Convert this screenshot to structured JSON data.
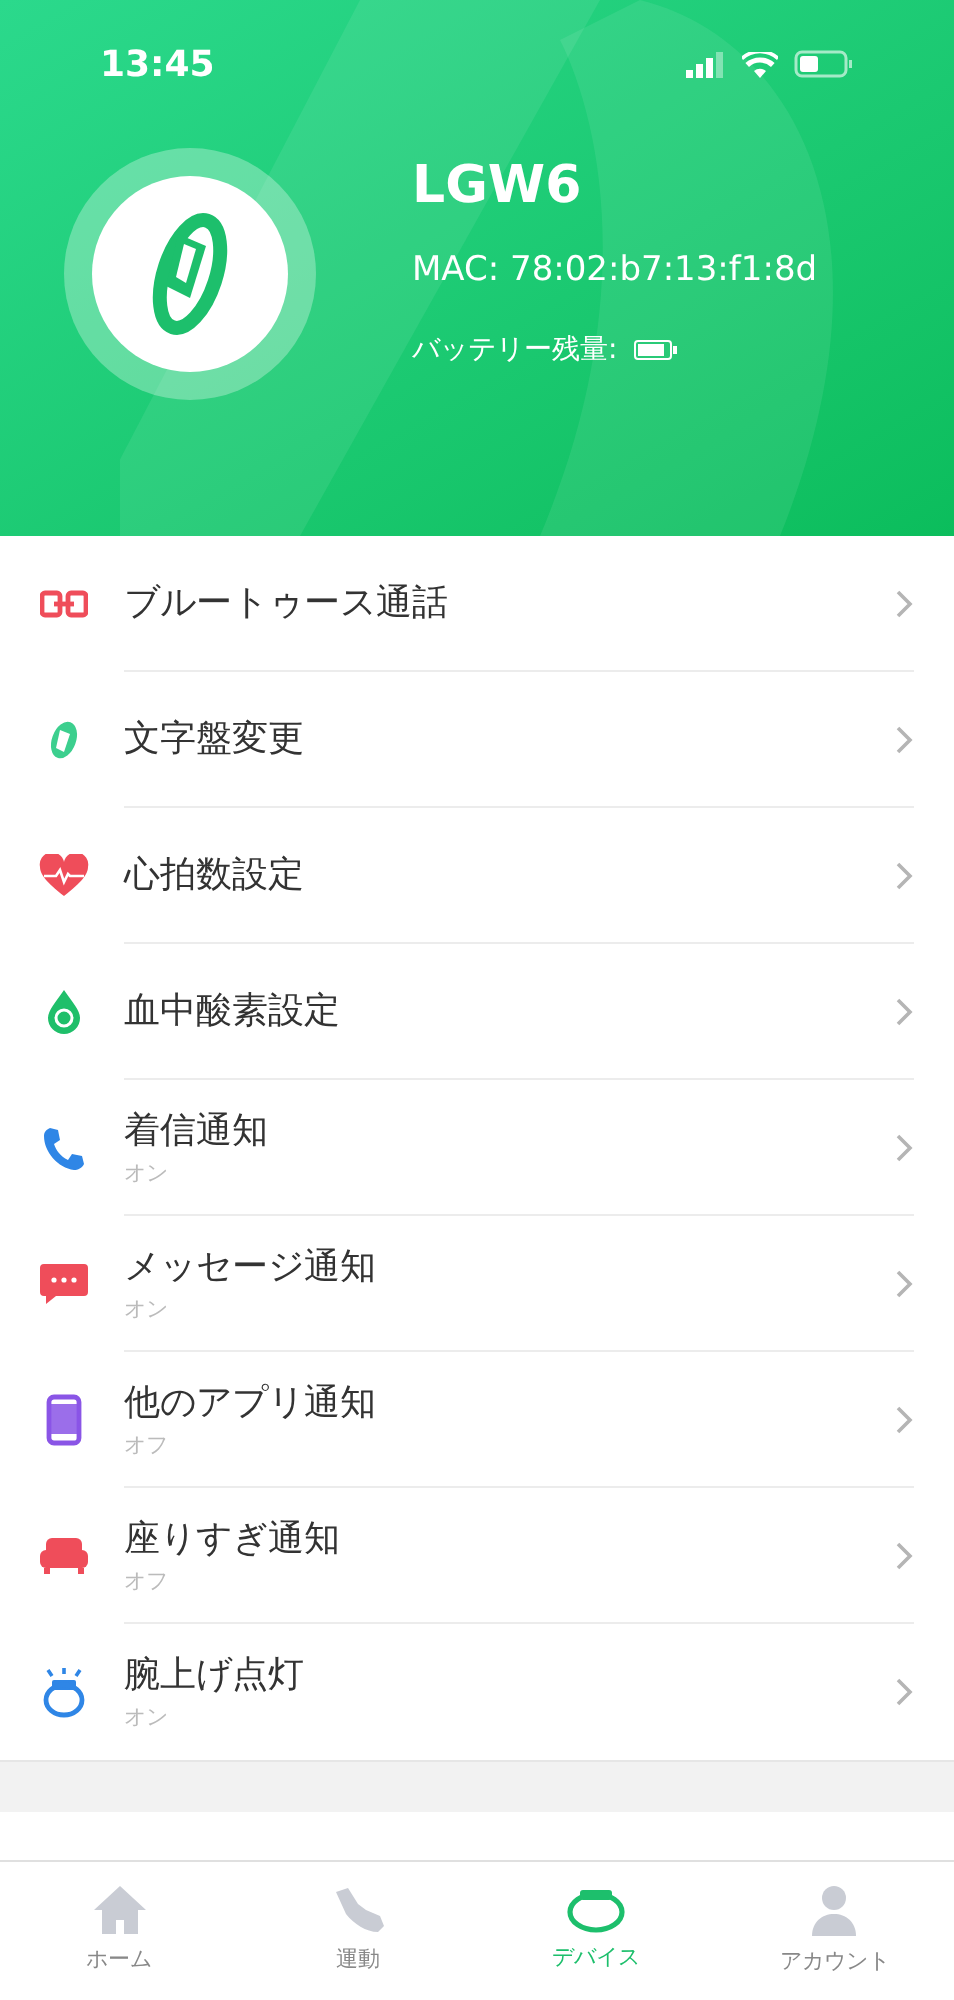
{
  "status_bar": {
    "time": "13:45"
  },
  "device": {
    "name": "LGW6",
    "mac": "MAC: 78:02:b7:13:f1:8d",
    "battery_label": "バッテリー残量:"
  },
  "menu": [
    {
      "label": "ブルートゥース通話"
    },
    {
      "label": "文字盤変更"
    },
    {
      "label": "心拍数設定"
    },
    {
      "label": "血中酸素設定"
    },
    {
      "label": "着信通知",
      "status": "オン"
    },
    {
      "label": "メッセージ通知",
      "status": "オン"
    },
    {
      "label": "他のアプリ通知",
      "status": "オフ"
    },
    {
      "label": "座りすぎ通知",
      "status": "オフ"
    },
    {
      "label": "腕上げ点灯",
      "status": "オン"
    }
  ],
  "tabs": [
    {
      "label": "ホーム",
      "selected": false
    },
    {
      "label": "運動",
      "selected": false
    },
    {
      "label": "デバイス",
      "selected": true
    },
    {
      "label": "アカウント",
      "selected": false
    }
  ]
}
